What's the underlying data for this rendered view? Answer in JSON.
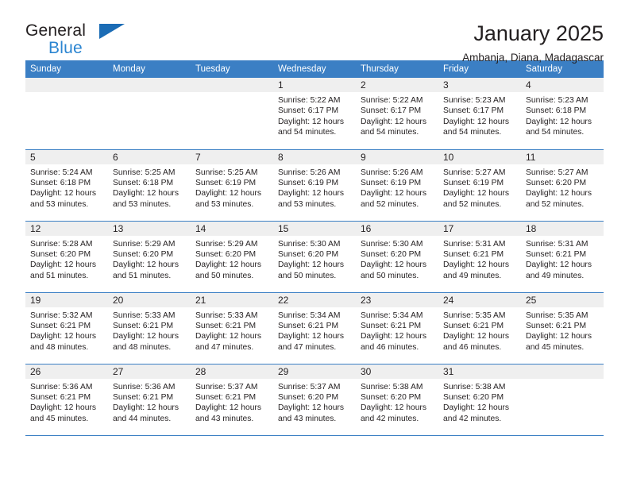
{
  "brand": {
    "line1": "General",
    "line2": "Blue",
    "triangle_color": "#1b6cb5",
    "blue_color": "#2b85d1"
  },
  "header": {
    "title": "January 2025",
    "subtitle": "Ambanja, Diana, Madagascar"
  },
  "theme": {
    "header_blue": "#3b7fc4",
    "daynum_gray": "#efefef",
    "text": "#231f20"
  },
  "weekdays": [
    "Sunday",
    "Monday",
    "Tuesday",
    "Wednesday",
    "Thursday",
    "Friday",
    "Saturday"
  ],
  "labels": {
    "sunrise": "Sunrise:",
    "sunset": "Sunset:",
    "daylight": "Daylight:"
  },
  "weeks": [
    [
      {
        "day": "",
        "sunrise": "",
        "sunset": "",
        "daylight": ""
      },
      {
        "day": "",
        "sunrise": "",
        "sunset": "",
        "daylight": ""
      },
      {
        "day": "",
        "sunrise": "",
        "sunset": "",
        "daylight": ""
      },
      {
        "day": "1",
        "sunrise": "Sunrise: 5:22 AM",
        "sunset": "Sunset: 6:17 PM",
        "daylight": "Daylight: 12 hours and 54 minutes."
      },
      {
        "day": "2",
        "sunrise": "Sunrise: 5:22 AM",
        "sunset": "Sunset: 6:17 PM",
        "daylight": "Daylight: 12 hours and 54 minutes."
      },
      {
        "day": "3",
        "sunrise": "Sunrise: 5:23 AM",
        "sunset": "Sunset: 6:17 PM",
        "daylight": "Daylight: 12 hours and 54 minutes."
      },
      {
        "day": "4",
        "sunrise": "Sunrise: 5:23 AM",
        "sunset": "Sunset: 6:18 PM",
        "daylight": "Daylight: 12 hours and 54 minutes."
      }
    ],
    [
      {
        "day": "5",
        "sunrise": "Sunrise: 5:24 AM",
        "sunset": "Sunset: 6:18 PM",
        "daylight": "Daylight: 12 hours and 53 minutes."
      },
      {
        "day": "6",
        "sunrise": "Sunrise: 5:25 AM",
        "sunset": "Sunset: 6:18 PM",
        "daylight": "Daylight: 12 hours and 53 minutes."
      },
      {
        "day": "7",
        "sunrise": "Sunrise: 5:25 AM",
        "sunset": "Sunset: 6:19 PM",
        "daylight": "Daylight: 12 hours and 53 minutes."
      },
      {
        "day": "8",
        "sunrise": "Sunrise: 5:26 AM",
        "sunset": "Sunset: 6:19 PM",
        "daylight": "Daylight: 12 hours and 53 minutes."
      },
      {
        "day": "9",
        "sunrise": "Sunrise: 5:26 AM",
        "sunset": "Sunset: 6:19 PM",
        "daylight": "Daylight: 12 hours and 52 minutes."
      },
      {
        "day": "10",
        "sunrise": "Sunrise: 5:27 AM",
        "sunset": "Sunset: 6:19 PM",
        "daylight": "Daylight: 12 hours and 52 minutes."
      },
      {
        "day": "11",
        "sunrise": "Sunrise: 5:27 AM",
        "sunset": "Sunset: 6:20 PM",
        "daylight": "Daylight: 12 hours and 52 minutes."
      }
    ],
    [
      {
        "day": "12",
        "sunrise": "Sunrise: 5:28 AM",
        "sunset": "Sunset: 6:20 PM",
        "daylight": "Daylight: 12 hours and 51 minutes."
      },
      {
        "day": "13",
        "sunrise": "Sunrise: 5:29 AM",
        "sunset": "Sunset: 6:20 PM",
        "daylight": "Daylight: 12 hours and 51 minutes."
      },
      {
        "day": "14",
        "sunrise": "Sunrise: 5:29 AM",
        "sunset": "Sunset: 6:20 PM",
        "daylight": "Daylight: 12 hours and 50 minutes."
      },
      {
        "day": "15",
        "sunrise": "Sunrise: 5:30 AM",
        "sunset": "Sunset: 6:20 PM",
        "daylight": "Daylight: 12 hours and 50 minutes."
      },
      {
        "day": "16",
        "sunrise": "Sunrise: 5:30 AM",
        "sunset": "Sunset: 6:20 PM",
        "daylight": "Daylight: 12 hours and 50 minutes."
      },
      {
        "day": "17",
        "sunrise": "Sunrise: 5:31 AM",
        "sunset": "Sunset: 6:21 PM",
        "daylight": "Daylight: 12 hours and 49 minutes."
      },
      {
        "day": "18",
        "sunrise": "Sunrise: 5:31 AM",
        "sunset": "Sunset: 6:21 PM",
        "daylight": "Daylight: 12 hours and 49 minutes."
      }
    ],
    [
      {
        "day": "19",
        "sunrise": "Sunrise: 5:32 AM",
        "sunset": "Sunset: 6:21 PM",
        "daylight": "Daylight: 12 hours and 48 minutes."
      },
      {
        "day": "20",
        "sunrise": "Sunrise: 5:33 AM",
        "sunset": "Sunset: 6:21 PM",
        "daylight": "Daylight: 12 hours and 48 minutes."
      },
      {
        "day": "21",
        "sunrise": "Sunrise: 5:33 AM",
        "sunset": "Sunset: 6:21 PM",
        "daylight": "Daylight: 12 hours and 47 minutes."
      },
      {
        "day": "22",
        "sunrise": "Sunrise: 5:34 AM",
        "sunset": "Sunset: 6:21 PM",
        "daylight": "Daylight: 12 hours and 47 minutes."
      },
      {
        "day": "23",
        "sunrise": "Sunrise: 5:34 AM",
        "sunset": "Sunset: 6:21 PM",
        "daylight": "Daylight: 12 hours and 46 minutes."
      },
      {
        "day": "24",
        "sunrise": "Sunrise: 5:35 AM",
        "sunset": "Sunset: 6:21 PM",
        "daylight": "Daylight: 12 hours and 46 minutes."
      },
      {
        "day": "25",
        "sunrise": "Sunrise: 5:35 AM",
        "sunset": "Sunset: 6:21 PM",
        "daylight": "Daylight: 12 hours and 45 minutes."
      }
    ],
    [
      {
        "day": "26",
        "sunrise": "Sunrise: 5:36 AM",
        "sunset": "Sunset: 6:21 PM",
        "daylight": "Daylight: 12 hours and 45 minutes."
      },
      {
        "day": "27",
        "sunrise": "Sunrise: 5:36 AM",
        "sunset": "Sunset: 6:21 PM",
        "daylight": "Daylight: 12 hours and 44 minutes."
      },
      {
        "day": "28",
        "sunrise": "Sunrise: 5:37 AM",
        "sunset": "Sunset: 6:21 PM",
        "daylight": "Daylight: 12 hours and 43 minutes."
      },
      {
        "day": "29",
        "sunrise": "Sunrise: 5:37 AM",
        "sunset": "Sunset: 6:20 PM",
        "daylight": "Daylight: 12 hours and 43 minutes."
      },
      {
        "day": "30",
        "sunrise": "Sunrise: 5:38 AM",
        "sunset": "Sunset: 6:20 PM",
        "daylight": "Daylight: 12 hours and 42 minutes."
      },
      {
        "day": "31",
        "sunrise": "Sunrise: 5:38 AM",
        "sunset": "Sunset: 6:20 PM",
        "daylight": "Daylight: 12 hours and 42 minutes."
      },
      {
        "day": "",
        "sunrise": "",
        "sunset": "",
        "daylight": ""
      }
    ]
  ]
}
